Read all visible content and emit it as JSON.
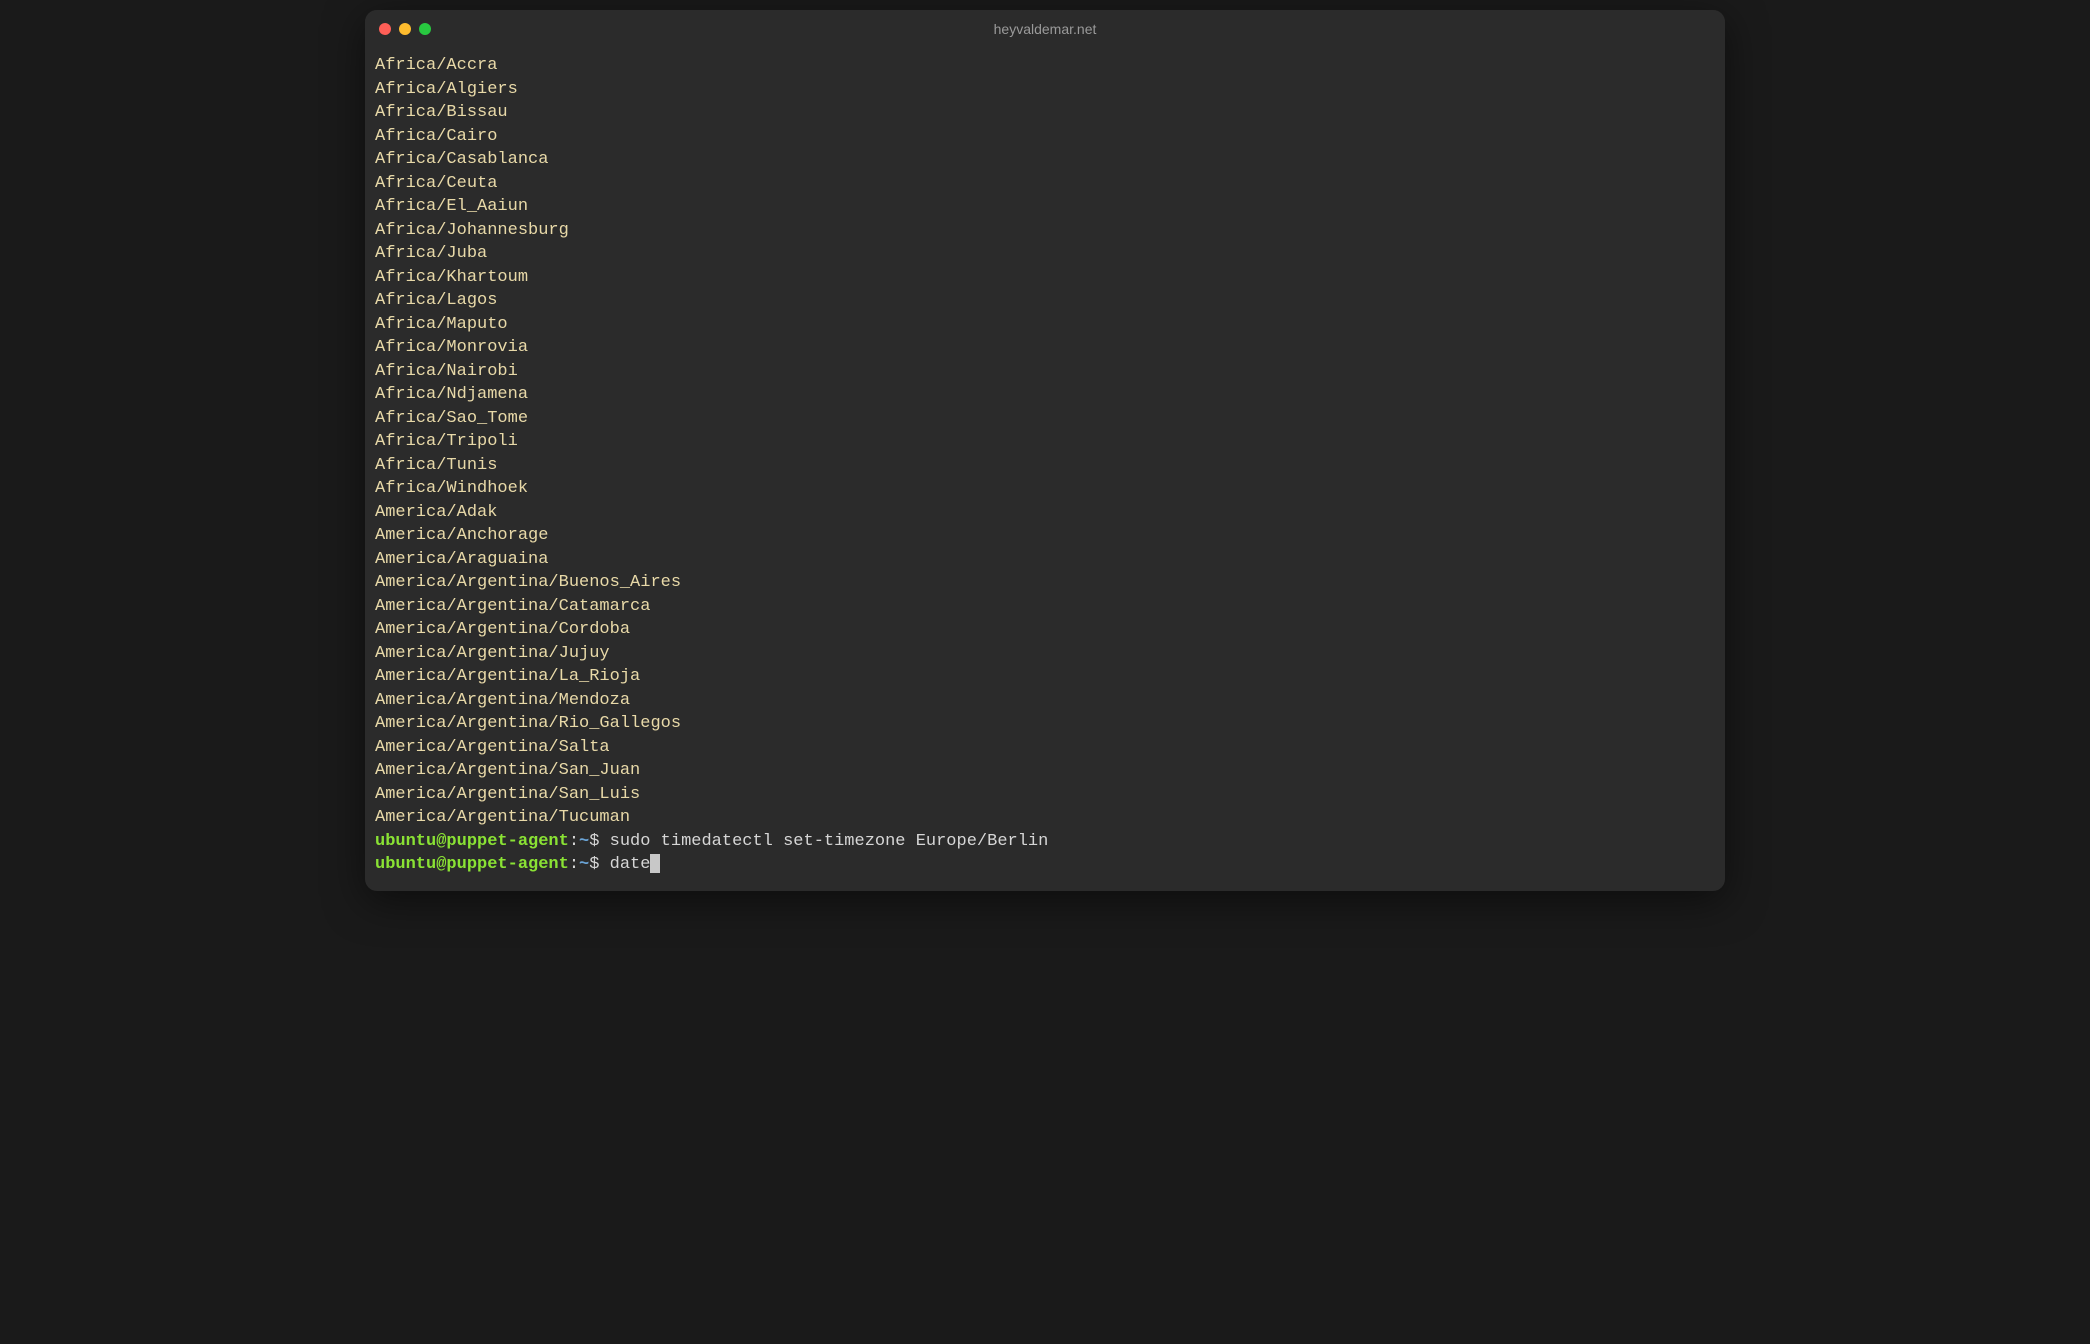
{
  "window": {
    "title": "heyvaldemar.net"
  },
  "timezones": [
    "Africa/Accra",
    "Africa/Algiers",
    "Africa/Bissau",
    "Africa/Cairo",
    "Africa/Casablanca",
    "Africa/Ceuta",
    "Africa/El_Aaiun",
    "Africa/Johannesburg",
    "Africa/Juba",
    "Africa/Khartoum",
    "Africa/Lagos",
    "Africa/Maputo",
    "Africa/Monrovia",
    "Africa/Nairobi",
    "Africa/Ndjamena",
    "Africa/Sao_Tome",
    "Africa/Tripoli",
    "Africa/Tunis",
    "Africa/Windhoek",
    "America/Adak",
    "America/Anchorage",
    "America/Araguaina",
    "America/Argentina/Buenos_Aires",
    "America/Argentina/Catamarca",
    "America/Argentina/Cordoba",
    "America/Argentina/Jujuy",
    "America/Argentina/La_Rioja",
    "America/Argentina/Mendoza",
    "America/Argentina/Rio_Gallegos",
    "America/Argentina/Salta",
    "America/Argentina/San_Juan",
    "America/Argentina/San_Luis",
    "America/Argentina/Tucuman"
  ],
  "prompt": {
    "user_host": "ubuntu@puppet-agent",
    "colon": ":",
    "path": "~",
    "symbol": "$ "
  },
  "commands": [
    "sudo timedatectl set-timezone Europe/Berlin",
    "date"
  ]
}
